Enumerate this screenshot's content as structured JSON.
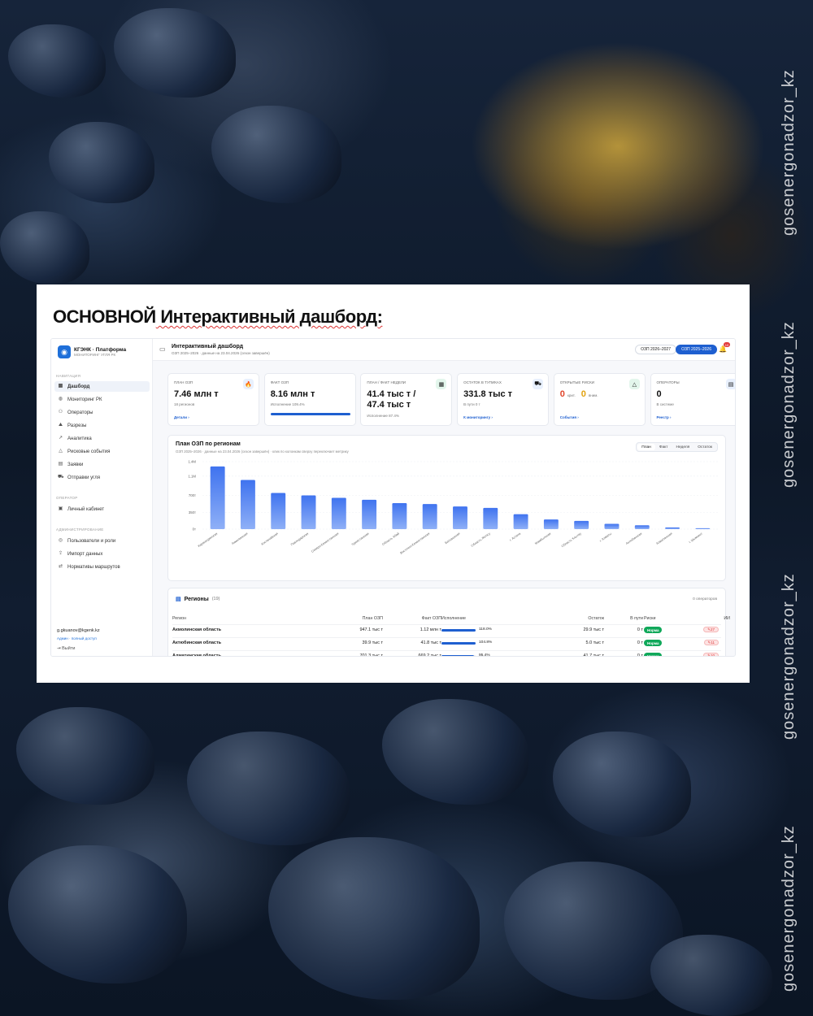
{
  "watermark": "gosenergonadzor_kz",
  "headline": {
    "bold": "ОСНОВНОЙ",
    "rest": " Интерактивный дашборд:"
  },
  "sidebar": {
    "brand": "КГЭНК · Платформа",
    "brand_sub": "МОНИТОРИНГ УГЛЯ РК",
    "section_nav": "НАВИГАЦИЯ",
    "items": [
      {
        "label": "Дашборд",
        "icon": "dashboard-icon",
        "glyph": "▦",
        "active": true
      },
      {
        "label": "Мониторинг РК",
        "icon": "globe-icon",
        "glyph": "◍"
      },
      {
        "label": "Операторы",
        "icon": "operators-icon",
        "glyph": "⚇"
      },
      {
        "label": "Разрезы",
        "icon": "mine-icon",
        "glyph": "⛰"
      },
      {
        "label": "Аналитика",
        "icon": "analytics-icon",
        "glyph": "↗"
      },
      {
        "label": "Рисковые события",
        "icon": "warning-icon",
        "glyph": "△"
      },
      {
        "label": "Заявки",
        "icon": "document-icon",
        "glyph": "▤"
      },
      {
        "label": "Отправки угля",
        "icon": "shipment-icon",
        "glyph": "⛟"
      }
    ],
    "section_operator": "ОПЕРАТОР",
    "operator_items": [
      {
        "label": "Личный кабинет",
        "icon": "cabinet-icon",
        "glyph": "▣"
      }
    ],
    "section_admin": "АДМИНИСТРИРОВАНИЕ",
    "admin_items": [
      {
        "label": "Пользователи и роли",
        "icon": "users-icon",
        "glyph": "◎"
      },
      {
        "label": "Импорт данных",
        "icon": "upload-icon",
        "glyph": "⇪"
      },
      {
        "label": "Нормативы маршрутов",
        "icon": "routes-icon",
        "glyph": "⇄"
      }
    ],
    "user_email": "g.gkuanov@kgenk.kz",
    "user_role": "Админ · полный доступ",
    "logout": "Выйти"
  },
  "topbar": {
    "title": "Интерактивный дашборд",
    "subtitle": "ОЗП 2025–2026 · данные на 23.04.2026 (сезон завершён)",
    "season_a": "ОЗП 2026–2027",
    "season_b": "ОЗП 2025–2026",
    "notifications": "10"
  },
  "kpis": [
    {
      "label": "План ОЗП",
      "value": "7.46 млн т",
      "sub": "18 регионов",
      "link": "Детали",
      "icon_glyph": "🔥",
      "icon_name": "fire-icon",
      "icon_bg": "#e8f0fd"
    },
    {
      "label": "Факт ОЗП",
      "value": "8.16 млн т",
      "sub": "Исполнение 109.4%",
      "progress": 1.0
    },
    {
      "label": "План / Факт недели",
      "value": "41.4 тыс т /",
      "value2": "47.4 тыс т",
      "sub": "Исполнение 87.4%",
      "icon_glyph": "▦",
      "icon_name": "calendar-icon",
      "icon_bg": "#e3f6ec"
    },
    {
      "label": "Остаток в тупиках",
      "value": "331.8 тыс т",
      "sub": "В пути 0 т",
      "link": "К мониторингу",
      "icon_glyph": "⛟",
      "icon_name": "truck-icon",
      "icon_bg": "#e8f0fd"
    },
    {
      "label": "Открытые риски",
      "crit": "0",
      "crit_label": "крит.",
      "attn": "0",
      "attn_label": "вним.",
      "link": "События",
      "icon_glyph": "△",
      "icon_name": "alert-icon",
      "icon_bg": "#e3f6ec"
    },
    {
      "label": "Операторы",
      "value": "0",
      "sub": "В системе",
      "link": "Реестр",
      "icon_glyph": "▤",
      "icon_name": "building-icon",
      "icon_bg": "#e8f0fd"
    }
  ],
  "chart_panel": {
    "title": "План ОЗП по регионам",
    "subtitle": "ОЗП 2025–2026 · данные на 23.04.2026 (сезон завершён) · клик по колонкам сверху переключает метрику",
    "tabs": [
      "План",
      "Факт",
      "Неделя",
      "Остаток"
    ]
  },
  "chart_data": {
    "type": "bar",
    "title": "План ОЗП по регионам",
    "ylim": [
      0,
      1400000
    ],
    "yticks": [
      {
        "v": 0,
        "label": "0т"
      },
      {
        "v": 350000,
        "label": "350т"
      },
      {
        "v": 700000,
        "label": "700т"
      },
      {
        "v": 1100000,
        "label": "1.1М"
      },
      {
        "v": 1400000,
        "label": "1.4М"
      }
    ],
    "categories": [
      "Карагандинская",
      "Акмолинская",
      "Костанайская",
      "Павлодарская",
      "Северо-Казахстанская",
      "Туркестанская",
      "Область Абай",
      "Восточно-Казахстанская",
      "Балхашская",
      "Область Жетісу",
      "г. Астана",
      "Жамбылская",
      "Область Ұлытау",
      "г. Алматы",
      "Актюбинская",
      "Алматинская",
      "г. Шымкент"
    ],
    "values": [
      1300000,
      1020000,
      750000,
      700000,
      650000,
      610000,
      540000,
      520000,
      470000,
      440000,
      310000,
      200000,
      170000,
      110000,
      80000,
      35000,
      20000
    ],
    "bar_color_top": "#3f73ef",
    "bar_color_bottom": "#8fb0f7",
    "grid": true
  },
  "table": {
    "title": "Регионы",
    "count": "(19)",
    "right_note": "0 операторов",
    "headers": [
      "Регион",
      "План ОЗП",
      "Факт ОЗП",
      "Исполнение",
      "Остаток",
      "В пути",
      "Риски",
      "ИИ"
    ],
    "rows": [
      {
        "region": "Акмолинская область",
        "plan": "947.1 тыс т",
        "fact": "1.12 млн т",
        "pct_label": "118.0%",
        "pct": 1.0,
        "rest": "29.9 тыс т",
        "transit": "0 т",
        "risk": "Норма",
        "ai": "27"
      },
      {
        "region": "Актюбинская область",
        "plan": "39.9 тыс т",
        "fact": "41.8 тыс т",
        "pct_label": "104.8%",
        "pct": 1.0,
        "rest": "5.0 тыс т",
        "transit": "0 т",
        "risk": "Норма",
        "ai": "11"
      },
      {
        "region": "Алматинская область",
        "plan": "701.3 тыс т",
        "fact": "669.2 тыс т",
        "pct_label": "95.4%",
        "pct": 0.954,
        "rest": "41.7 тыс т",
        "transit": "0 т",
        "risk": "Норма",
        "ai": "10"
      }
    ]
  }
}
